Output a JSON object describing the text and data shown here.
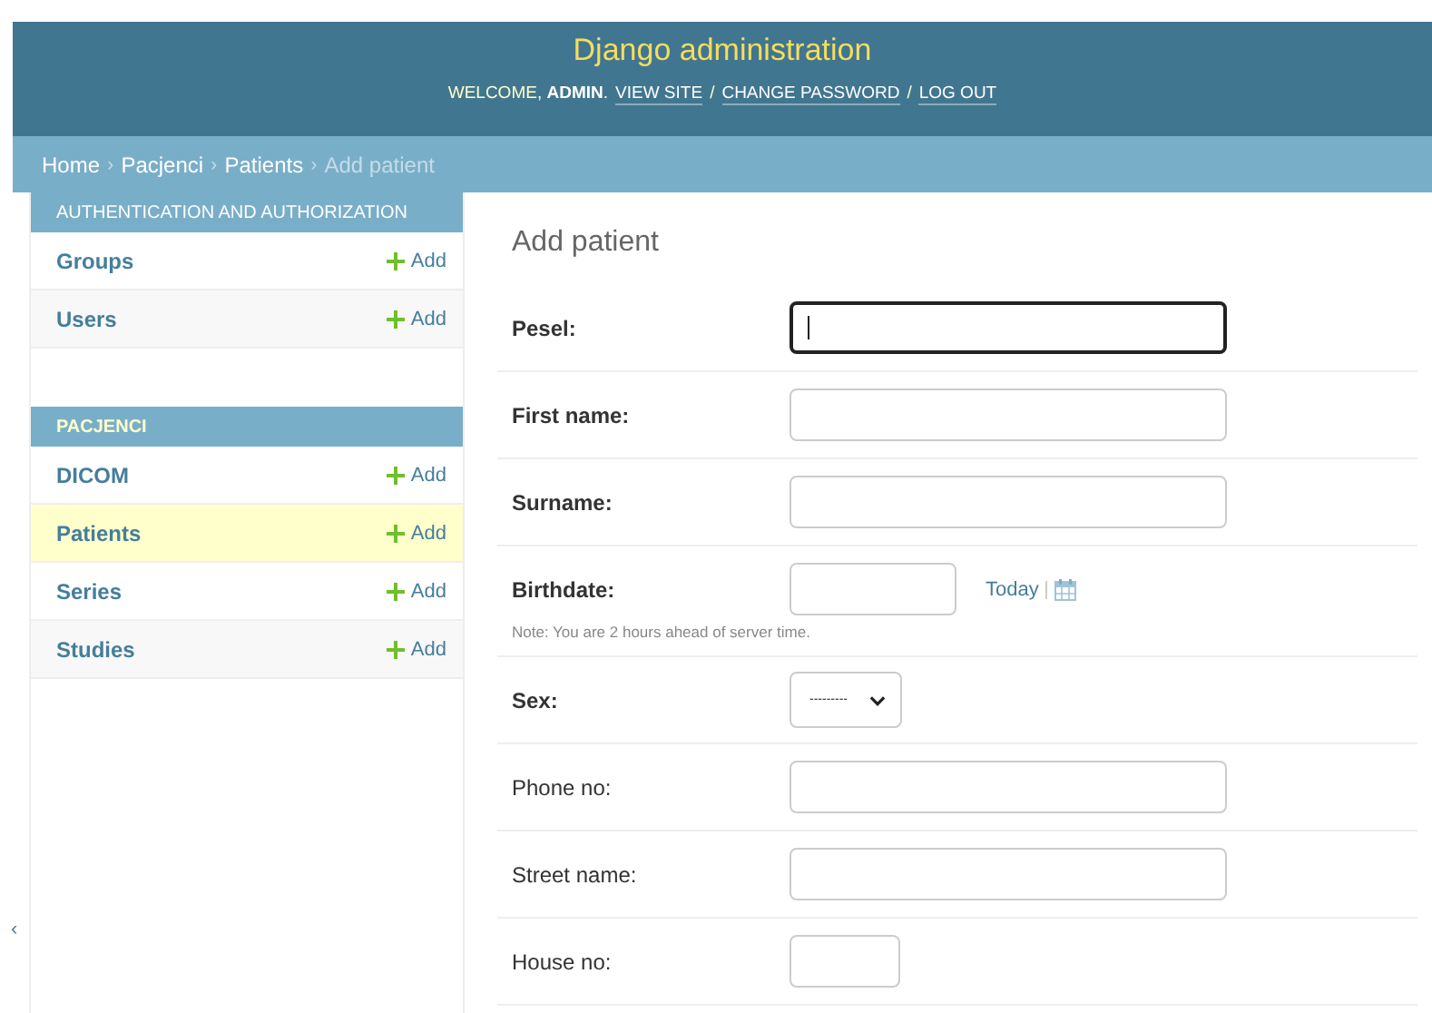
{
  "header": {
    "title": "Django administration",
    "welcome": "WELCOME, **ADMIN**.",
    "separator": "/",
    "links": [
      "VIEW SITE",
      "CHANGE PASSWORD",
      "LOG OUT"
    ]
  },
  "breadcrumb_separator": "›",
  "breadcrumbs": [
    {
      "label": "Home",
      "current": false
    },
    {
      "label": "Pacjenci",
      "current": false
    },
    {
      "label": "Patients",
      "current": false
    },
    {
      "label": "Add patient",
      "current": true
    }
  ],
  "sidebar": {
    "toggle": "‹",
    "modules": [
      {
        "caption": "AUTHENTICATION AND AUTHORIZATION",
        "highlight": false,
        "items": [
          {
            "name": "Groups",
            "add": "Add",
            "selected": false
          },
          {
            "name": "Users",
            "add": "Add",
            "selected": false
          }
        ]
      },
      {
        "caption": "PACJENCI",
        "highlight": true,
        "items": [
          {
            "name": "DICOM",
            "add": "Add",
            "selected": false
          },
          {
            "name": "Patients",
            "add": "Add",
            "selected": true
          },
          {
            "name": "Series",
            "add": "Add",
            "selected": false
          },
          {
            "name": "Studies",
            "add": "Add",
            "selected": false
          }
        ]
      }
    ]
  },
  "content": {
    "title": "Add patient",
    "fields": [
      {
        "label": "Pesel:",
        "kind": "text",
        "required": true,
        "focused": true
      },
      {
        "label": "First name:",
        "kind": "text",
        "required": true,
        "focused": false
      },
      {
        "label": "Surname:",
        "kind": "text",
        "required": true,
        "focused": false
      },
      {
        "label": "Birthdate:",
        "kind": "date",
        "required": true,
        "focused": false,
        "today": "Today",
        "note": "Note: You are 2 hours ahead of server time."
      },
      {
        "label": "Sex:",
        "kind": "select",
        "required": true,
        "focused": false,
        "value": "---------"
      },
      {
        "label": "Phone no:",
        "kind": "text",
        "required": false,
        "focused": false
      },
      {
        "label": "Street name:",
        "kind": "text",
        "required": false,
        "focused": false
      },
      {
        "label": "House no:",
        "kind": "number",
        "required": false,
        "focused": false
      }
    ]
  }
}
